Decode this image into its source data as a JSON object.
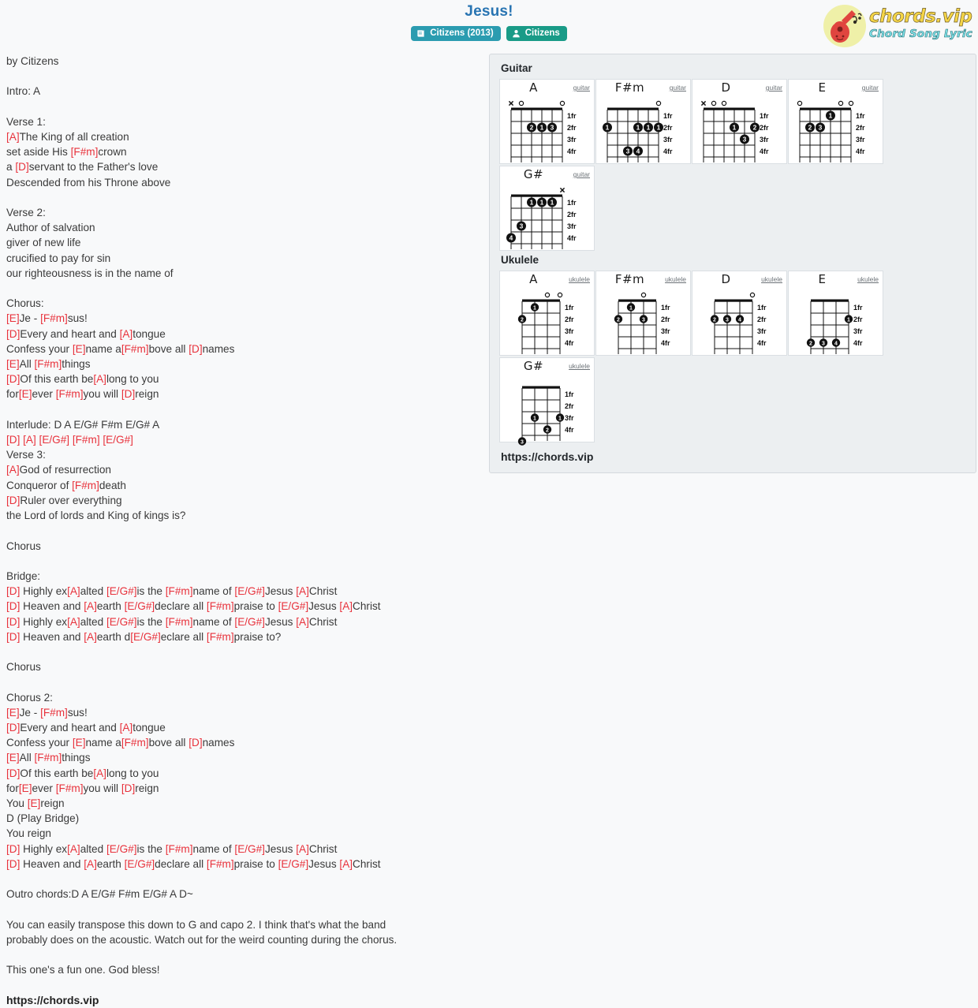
{
  "header": {
    "title": "Jesus!",
    "badges": [
      {
        "label": "Citizens (2013)",
        "icon": "album-icon",
        "color": "#2b9cb0"
      },
      {
        "label": "Citizens",
        "icon": "user-icon",
        "color": "#199b87"
      }
    ],
    "logo": {
      "main": "chords.vip",
      "sub": "Chord Song Lyric",
      "icon": "guitar-icon"
    }
  },
  "lyrics": {
    "lines": [
      {
        "t": "by Citizens"
      },
      {
        "t": ""
      },
      {
        "t": "Intro: A"
      },
      {
        "t": ""
      },
      {
        "t": "Verse 1:"
      },
      {
        "p": [
          {
            "c": "[A]"
          },
          {
            "x": "The King of all creation"
          }
        ]
      },
      {
        "p": [
          {
            "x": "set aside His "
          },
          {
            "c": "[F#m]"
          },
          {
            "x": "crown"
          }
        ]
      },
      {
        "p": [
          {
            "x": "a "
          },
          {
            "c": "[D]"
          },
          {
            "x": "servant to the Father's love"
          }
        ]
      },
      {
        "t": "Descended from his Throne above"
      },
      {
        "t": ""
      },
      {
        "t": "Verse 2:"
      },
      {
        "t": "Author of salvation"
      },
      {
        "t": "giver of new life"
      },
      {
        "t": "crucified to pay for sin"
      },
      {
        "t": "our righteousness is in the name of"
      },
      {
        "t": ""
      },
      {
        "t": "Chorus:"
      },
      {
        "p": [
          {
            "c": "[E]"
          },
          {
            "x": "Je - "
          },
          {
            "c": "[F#m]"
          },
          {
            "x": "sus!"
          }
        ]
      },
      {
        "p": [
          {
            "c": "[D]"
          },
          {
            "x": "Every and heart and "
          },
          {
            "c": "[A]"
          },
          {
            "x": "tongue"
          }
        ]
      },
      {
        "p": [
          {
            "x": "Confess your "
          },
          {
            "c": "[E]"
          },
          {
            "x": "name a"
          },
          {
            "c": "[F#m]"
          },
          {
            "x": "bove all "
          },
          {
            "c": "[D]"
          },
          {
            "x": "names"
          }
        ]
      },
      {
        "p": [
          {
            "c": "[E]"
          },
          {
            "x": "All "
          },
          {
            "c": "[F#m]"
          },
          {
            "x": "things"
          }
        ]
      },
      {
        "p": [
          {
            "c": "[D]"
          },
          {
            "x": "Of this earth be"
          },
          {
            "c": "[A]"
          },
          {
            "x": "long to you"
          }
        ]
      },
      {
        "p": [
          {
            "x": "for"
          },
          {
            "c": "[E]"
          },
          {
            "x": "ever "
          },
          {
            "c": "[F#m]"
          },
          {
            "x": "you will "
          },
          {
            "c": "[D]"
          },
          {
            "x": "reign"
          }
        ]
      },
      {
        "t": ""
      },
      {
        "t": "Interlude: D A E/G# F#m E/G# A"
      },
      {
        "p": [
          {
            "c": "[D] [A] [E/G#] [F#m] [E/G#]"
          }
        ]
      },
      {
        "t": "Verse 3:"
      },
      {
        "p": [
          {
            "c": "[A]"
          },
          {
            "x": "God of resurrection"
          }
        ]
      },
      {
        "p": [
          {
            "x": "Conqueror of "
          },
          {
            "c": "[F#m]"
          },
          {
            "x": "death"
          }
        ]
      },
      {
        "p": [
          {
            "c": "[D]"
          },
          {
            "x": "Ruler over everything"
          }
        ]
      },
      {
        "t": "the Lord of lords and King of kings is?"
      },
      {
        "t": ""
      },
      {
        "t": "Chorus"
      },
      {
        "t": ""
      },
      {
        "t": "Bridge:"
      },
      {
        "p": [
          {
            "c": "[D]"
          },
          {
            "x": " Highly ex"
          },
          {
            "c": "[A]"
          },
          {
            "x": "alted "
          },
          {
            "c": "[E/G#]"
          },
          {
            "x": "is the "
          },
          {
            "c": "[F#m]"
          },
          {
            "x": "name of "
          },
          {
            "c": "[E/G#]"
          },
          {
            "x": "Jesus "
          },
          {
            "c": "[A]"
          },
          {
            "x": "Christ"
          }
        ]
      },
      {
        "p": [
          {
            "c": "[D]"
          },
          {
            "x": " Heaven and "
          },
          {
            "c": "[A]"
          },
          {
            "x": "earth "
          },
          {
            "c": "[E/G#]"
          },
          {
            "x": "declare all "
          },
          {
            "c": "[F#m]"
          },
          {
            "x": "praise to "
          },
          {
            "c": "[E/G#]"
          },
          {
            "x": "Jesus "
          },
          {
            "c": "[A]"
          },
          {
            "x": "Christ"
          }
        ]
      },
      {
        "p": [
          {
            "c": "[D]"
          },
          {
            "x": " Highly ex"
          },
          {
            "c": "[A]"
          },
          {
            "x": "alted "
          },
          {
            "c": "[E/G#]"
          },
          {
            "x": "is the "
          },
          {
            "c": "[F#m]"
          },
          {
            "x": "name of "
          },
          {
            "c": "[E/G#]"
          },
          {
            "x": "Jesus "
          },
          {
            "c": "[A]"
          },
          {
            "x": "Christ"
          }
        ]
      },
      {
        "p": [
          {
            "c": "[D]"
          },
          {
            "x": " Heaven and "
          },
          {
            "c": "[A]"
          },
          {
            "x": "earth d"
          },
          {
            "c": "[E/G#]"
          },
          {
            "x": "eclare all "
          },
          {
            "c": "[F#m]"
          },
          {
            "x": "praise to?"
          }
        ]
      },
      {
        "t": ""
      },
      {
        "t": "Chorus"
      },
      {
        "t": ""
      },
      {
        "t": "Chorus 2:"
      },
      {
        "p": [
          {
            "c": "[E]"
          },
          {
            "x": "Je - "
          },
          {
            "c": "[F#m]"
          },
          {
            "x": "sus!"
          }
        ]
      },
      {
        "p": [
          {
            "c": "[D]"
          },
          {
            "x": "Every and heart and "
          },
          {
            "c": "[A]"
          },
          {
            "x": "tongue"
          }
        ]
      },
      {
        "p": [
          {
            "x": "Confess your "
          },
          {
            "c": "[E]"
          },
          {
            "x": "name a"
          },
          {
            "c": "[F#m]"
          },
          {
            "x": "bove all "
          },
          {
            "c": "[D]"
          },
          {
            "x": "names"
          }
        ]
      },
      {
        "p": [
          {
            "c": "[E]"
          },
          {
            "x": "All "
          },
          {
            "c": "[F#m]"
          },
          {
            "x": "things"
          }
        ]
      },
      {
        "p": [
          {
            "c": "[D]"
          },
          {
            "x": "Of this earth be"
          },
          {
            "c": "[A]"
          },
          {
            "x": "long to you"
          }
        ]
      },
      {
        "p": [
          {
            "x": "for"
          },
          {
            "c": "[E]"
          },
          {
            "x": "ever "
          },
          {
            "c": "[F#m]"
          },
          {
            "x": "you will "
          },
          {
            "c": "[D]"
          },
          {
            "x": "reign"
          }
        ]
      },
      {
        "p": [
          {
            "x": "You "
          },
          {
            "c": "[E]"
          },
          {
            "x": "reign"
          }
        ]
      },
      {
        "t": "D (Play Bridge)"
      },
      {
        "t": "You reign"
      },
      {
        "p": [
          {
            "c": "[D]"
          },
          {
            "x": " Highly ex"
          },
          {
            "c": "[A]"
          },
          {
            "x": "alted "
          },
          {
            "c": "[E/G#]"
          },
          {
            "x": "is the "
          },
          {
            "c": "[F#m]"
          },
          {
            "x": "name of "
          },
          {
            "c": "[E/G#]"
          },
          {
            "x": "Jesus "
          },
          {
            "c": "[A]"
          },
          {
            "x": "Christ"
          }
        ]
      },
      {
        "p": [
          {
            "c": "[D]"
          },
          {
            "x": " Heaven and "
          },
          {
            "c": "[A]"
          },
          {
            "x": "earth "
          },
          {
            "c": "[E/G#]"
          },
          {
            "x": "declare all "
          },
          {
            "c": "[F#m]"
          },
          {
            "x": "praise to "
          },
          {
            "c": "[E/G#]"
          },
          {
            "x": "Jesus "
          },
          {
            "c": "[A]"
          },
          {
            "x": "Christ"
          }
        ]
      },
      {
        "t": ""
      },
      {
        "t": "Outro chords:D A E/G# F#m E/G# A D~"
      },
      {
        "t": ""
      },
      {
        "t": "You can easily transpose this down to G and capo 2. I think that's what the band"
      },
      {
        "t": "probably does on the acoustic. Watch out for the weird counting during the chorus."
      },
      {
        "t": ""
      },
      {
        "t": "This one's a fun one. God bless!"
      },
      {
        "t": ""
      },
      {
        "t": "https://chords.vip",
        "bold": true
      }
    ]
  },
  "chords": {
    "guitar_title": "Guitar",
    "ukulele_title": "Ukulele",
    "panel_url": "https://chords.vip",
    "fret_labels": [
      "1fr",
      "2fr",
      "3fr",
      "4fr"
    ],
    "guitar": [
      {
        "name": "A",
        "instrument": "guitar",
        "strings": 6,
        "open": [
          "x",
          "o",
          "",
          "",
          "",
          "o"
        ],
        "dots": [
          {
            "s": 3,
            "f": 2,
            "n": "2"
          },
          {
            "s": 4,
            "f": 2,
            "n": "1"
          },
          {
            "s": 5,
            "f": 2,
            "n": "3"
          }
        ]
      },
      {
        "name": "F#m",
        "instrument": "guitar",
        "strings": 6,
        "open": [
          "",
          "",
          "",
          "",
          "",
          "o"
        ],
        "dots": [
          {
            "s": 1,
            "f": 2,
            "n": "1"
          },
          {
            "s": 4,
            "f": 2,
            "n": "1"
          },
          {
            "s": 5,
            "f": 2,
            "n": "1"
          },
          {
            "s": 6,
            "f": 2,
            "n": "1"
          },
          {
            "s": 3,
            "f": 4,
            "n": "3"
          },
          {
            "s": 4,
            "f": 4,
            "n": "4"
          }
        ]
      },
      {
        "name": "D",
        "instrument": "guitar",
        "strings": 6,
        "open": [
          "x",
          "o",
          "o",
          "",
          "",
          ""
        ],
        "dots": [
          {
            "s": 4,
            "f": 2,
            "n": "1"
          },
          {
            "s": 6,
            "f": 2,
            "n": "2"
          },
          {
            "s": 5,
            "f": 3,
            "n": "3"
          }
        ]
      },
      {
        "name": "E",
        "instrument": "guitar",
        "strings": 6,
        "open": [
          "o",
          "",
          "",
          "",
          "o",
          "o"
        ],
        "dots": [
          {
            "s": 4,
            "f": 1,
            "n": "1"
          },
          {
            "s": 2,
            "f": 2,
            "n": "2"
          },
          {
            "s": 3,
            "f": 2,
            "n": "3"
          }
        ]
      },
      {
        "name": "G#",
        "instrument": "guitar",
        "strings": 6,
        "open": [
          "",
          "",
          "",
          "",
          "",
          "x"
        ],
        "dots": [
          {
            "s": 3,
            "f": 1,
            "n": "1"
          },
          {
            "s": 4,
            "f": 1,
            "n": "1"
          },
          {
            "s": 5,
            "f": 1,
            "n": "1"
          },
          {
            "s": 2,
            "f": 3,
            "n": "3"
          },
          {
            "s": 1,
            "f": 4,
            "n": "4"
          }
        ]
      }
    ],
    "ukulele": [
      {
        "name": "A",
        "instrument": "ukulele",
        "strings": 4,
        "open": [
          "",
          "",
          "o",
          "o"
        ],
        "dots": [
          {
            "s": 2,
            "f": 1,
            "n": "1"
          },
          {
            "s": 1,
            "f": 2,
            "n": "2"
          }
        ]
      },
      {
        "name": "F#m",
        "instrument": "ukulele",
        "strings": 4,
        "open": [
          "",
          "",
          "o",
          ""
        ],
        "dots": [
          {
            "s": 2,
            "f": 1,
            "n": "1"
          },
          {
            "s": 1,
            "f": 2,
            "n": "2"
          },
          {
            "s": 3,
            "f": 2,
            "n": "3"
          }
        ]
      },
      {
        "name": "D",
        "instrument": "ukulele",
        "strings": 4,
        "open": [
          "",
          "",
          "",
          "o"
        ],
        "dots": [
          {
            "s": 1,
            "f": 2,
            "n": "2"
          },
          {
            "s": 2,
            "f": 2,
            "n": "3"
          },
          {
            "s": 3,
            "f": 2,
            "n": "4"
          }
        ]
      },
      {
        "name": "E",
        "instrument": "ukulele",
        "strings": 4,
        "open": [
          "",
          "",
          "",
          ""
        ],
        "dots": [
          {
            "s": 4,
            "f": 2,
            "n": "1"
          },
          {
            "s": 1,
            "f": 4,
            "n": "2"
          },
          {
            "s": 2,
            "f": 4,
            "n": "3"
          },
          {
            "s": 3,
            "f": 4,
            "n": "4"
          }
        ]
      },
      {
        "name": "G#",
        "instrument": "ukulele",
        "strings": 4,
        "open": [
          "",
          "",
          "",
          ""
        ],
        "dots": [
          {
            "s": 2,
            "f": 3,
            "n": "1"
          },
          {
            "s": 4,
            "f": 3,
            "n": "1"
          },
          {
            "s": 3,
            "f": 4,
            "n": "2"
          },
          {
            "s": 1,
            "f": 5,
            "n": "3"
          }
        ]
      }
    ]
  }
}
